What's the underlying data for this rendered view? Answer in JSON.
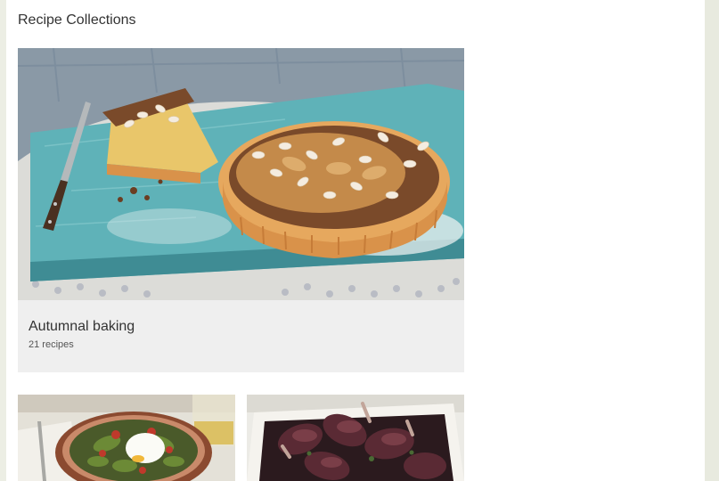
{
  "section": {
    "title": "Recipe Collections"
  },
  "featured": {
    "title": "Autumnal baking",
    "count": "21 recipes",
    "image_icon": "pear-almond-tart-image"
  },
  "collections": [
    {
      "image_icon": "poached-egg-salad-image"
    },
    {
      "image_icon": "roast-lamb-shanks-image"
    }
  ],
  "colors": {
    "background": "#eceee4",
    "card": "#efefef",
    "text": "#333333"
  }
}
